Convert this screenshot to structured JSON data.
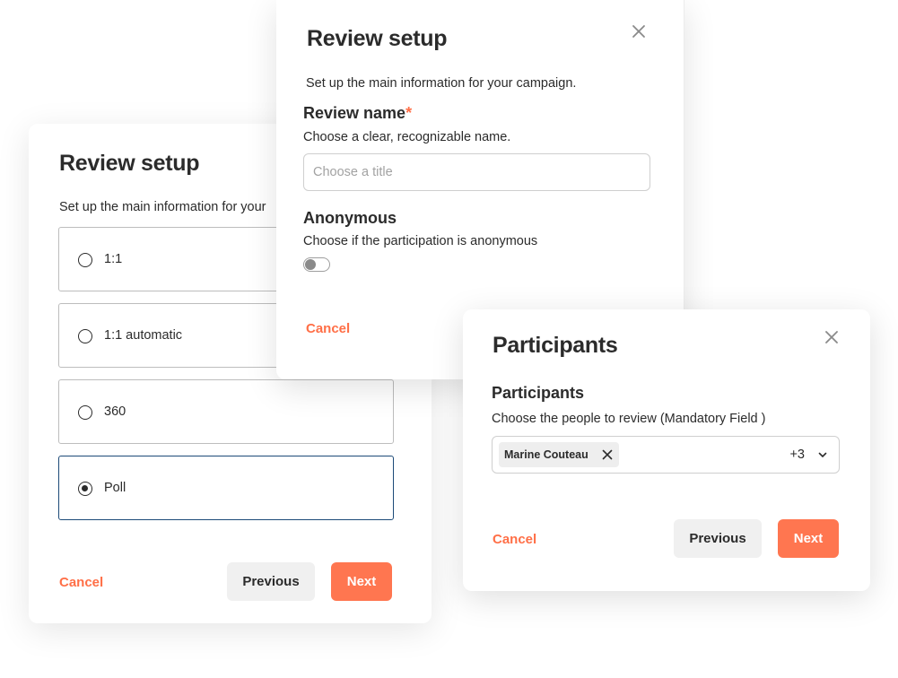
{
  "left_dialog": {
    "title": "Review setup",
    "description": "Set up the main information for your",
    "options": [
      {
        "label": "1:1",
        "selected": false
      },
      {
        "label": "1:1 automatic",
        "selected": false
      },
      {
        "label": "360",
        "selected": false
      },
      {
        "label": "Poll",
        "selected": true
      }
    ],
    "cancel_label": "Cancel",
    "previous_label": "Previous",
    "next_label": "Next"
  },
  "top_dialog": {
    "title": "Review setup",
    "description": "Set up the main information for your campaign.",
    "name_label": "Review name",
    "required_mark": "*",
    "name_help": "Choose a clear, recognizable name.",
    "name_value": "",
    "name_placeholder": "Choose a title",
    "anonymous_label": "Anonymous",
    "anonymous_help": "Choose if the participation is anonymous",
    "anonymous_enabled": false,
    "cancel_label": "Cancel"
  },
  "right_dialog": {
    "title": "Participants",
    "section_label": "Participants",
    "section_help": "Choose the people to review (Mandatory Field )",
    "selected_chip": "Marine Couteau",
    "more_count": "+3",
    "cancel_label": "Cancel",
    "previous_label": "Previous",
    "next_label": "Next"
  },
  "colors": {
    "accent": "#ff7650",
    "link": "#ff6f47",
    "selected_border": "#1c4a78",
    "text": "#2b2b2b"
  },
  "icons": {
    "close": "close-icon",
    "chip_remove": "close-icon",
    "dropdown": "chevron-down-icon"
  }
}
